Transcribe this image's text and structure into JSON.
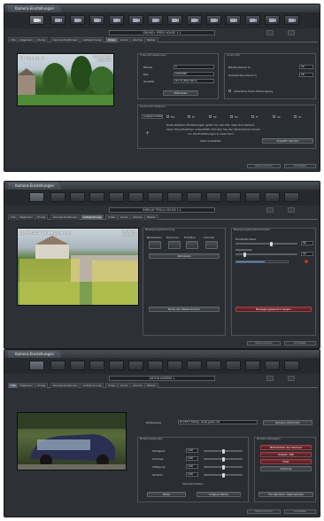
{
  "title": "Kamera-Einstellungen",
  "camera_name": "GRUND+ PREIS HOUSE 1.1",
  "tabs": [
    "Info",
    "Allgemein",
    "Prolog",
    "Kennwortoptionen",
    "Aufzeichnung",
    "Video",
    "Audio",
    "Alarme",
    "Netzw."
  ],
  "window1": {
    "overlay_name": "C1 Camera 1",
    "overlay_date": "03.06.2010",
    "overlay_time": "12:00:00",
    "settings_title": "Video-Einstellungen",
    "bitrate_label": "Bitrate",
    "bitrate_value": "1",
    "res_label": "Res.",
    "res_value": "640x480",
    "quality_label": "Qualität",
    "quality_value": "Hoch (Standard)",
    "apply": "Aktivieren",
    "audio_title": "Audio-Info",
    "audio_label1": "Bitrate (Kanal 1)",
    "audio_label2": "Samplerate (Kanal 2)",
    "audio_val1": "32",
    "audio_val2": "16",
    "audio_check": "Aktivierte Audio-Übertragung",
    "schedule_title": "Audio-Info Zeitplan",
    "days": [
      "Mo",
      "Di",
      "Mi",
      "Do",
      "Fr",
      "Sa",
      "So"
    ],
    "dropdown": "ausgeschaltet",
    "note1": "Diese Zeitplan-Einstellungen gelten für den Fall, dass Ihre Kamera",
    "note2": "keine Tonaufnahmen unterstützt. Drücken Sie den Übernehmen-Knopf",
    "note3": "um die Einstellungen zu speichern.",
    "link1": "Alles auswählen",
    "link2": "Auswahl löschen",
    "ok": "Übernehmen",
    "cancel": "Schließen"
  },
  "window2": {
    "camera_name": "INRELAY TROLA HOUSE 1.1",
    "overlay_name": "CL IP-CCTV bildeq.com-sh",
    "overlay_date": "09-07-05",
    "overlay_time": "12:16:50",
    "motion_title": "Bewegungserkennung",
    "zone_labels": [
      "Bearbeiten",
      "Zeichnen",
      "Einfüllen",
      "Löschen"
    ],
    "apply": "Aktivieren",
    "color_button": "Farbe der Maske ändern",
    "sens_title": "Bewegungsempfindlichkeit",
    "sens_label1": "Empfindlichkeit",
    "sens_label2": "Objektgröße",
    "sens_val1": "56",
    "sens_val2": "10",
    "show_button": "Bewegungsbereich zeigen",
    "ok": "Übernehmen",
    "cancel": "Schließen"
  },
  "window3": {
    "camera_name": "ANTON KAMERA 1",
    "url_label": "Bildadresse",
    "url_value": "IP-CCTV bildeq. www.geek.net",
    "url_button": "Kamera verbinden",
    "image_title": "Bildeinstellungen",
    "rows": [
      "Helligkeit",
      "Kontrast",
      "Sättigung",
      "Schärfe"
    ],
    "values": [
      "128",
      "128",
      "128",
      "128"
    ],
    "reset_link": "Standard laden...",
    "color_button": "Farbe",
    "default_button": "Original Werte",
    "right_title": "Rotation/Spiegeln",
    "right_buttons": [
      "Bildrotation der Kamera",
      "Drehen 180",
      "Oder",
      "Drehung"
    ],
    "apply_button": "Für alle Kam. übernehmen",
    "ok": "Übernehmen",
    "cancel": "Schließen"
  }
}
